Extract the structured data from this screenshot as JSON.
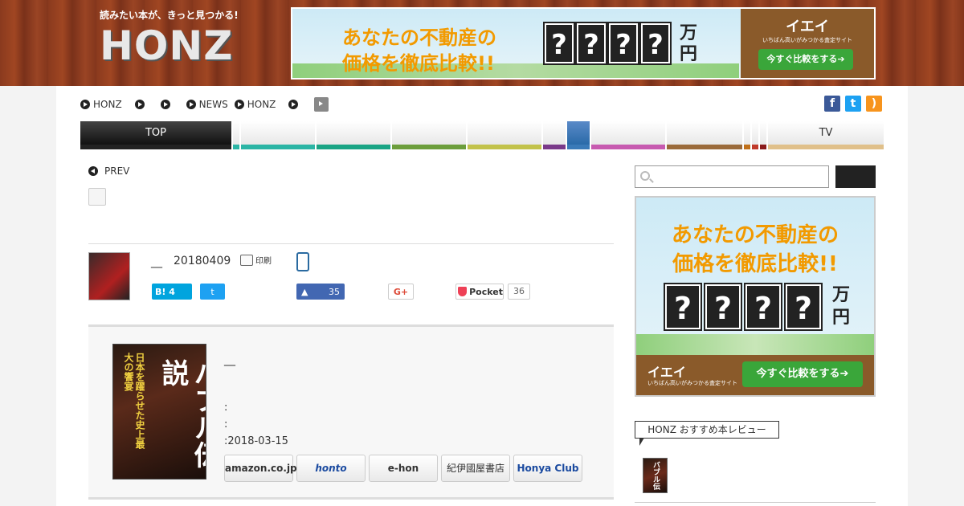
{
  "header": {
    "tagline": "読みたい本が、きっと見つかる!",
    "logo": "HONZ",
    "banner": {
      "line1": "あなたの不動産の",
      "line2": "価格を徹底比較!!",
      "mark": "?",
      "unit": "万円",
      "brand": "イエイ",
      "sub": "いちばん高いがみつかる査定サイト",
      "cta": "今すぐ比較をする➔"
    }
  },
  "breadcrumb": {
    "items": [
      "HONZ",
      "",
      "",
      "NEWS",
      "HONZ",
      "",
      ""
    ]
  },
  "social_colors": {
    "facebook": "#3b5998",
    "twitter": "#1da1f2",
    "rss": "#f7941d"
  },
  "nav": {
    "top_label": "TOP",
    "tv_label": "TV",
    "colors": [
      "#222222",
      "#2bb5a5",
      "#1aa585",
      "#16956a",
      "#6c9e3c",
      "#c2c24a",
      "#7a3a8a",
      "#3a7ab8",
      "#c75ab0",
      "#9a6a3a",
      "#c0701a",
      "#c03a2a",
      "#8a1a1a",
      "#e0c08a"
    ]
  },
  "article": {
    "prev_label": "PREV",
    "author_name": "__",
    "date": "20180409",
    "print_label": "印刷",
    "hatena_label": "B!",
    "hatena_count": "4",
    "fb_count": "35",
    "gplus_label": "G+",
    "pocket_label": "Pocket",
    "pocket_count": "36"
  },
  "book": {
    "cover_sub": "日本を躍らせた史上最大の饗宴",
    "cover_title": "バブル伝説",
    "title": "__",
    "meta1": ":",
    "meta2": ":",
    "meta3": ":2018-03-15",
    "stores": [
      "amazon.co.jp",
      "honto",
      "e-hon",
      "紀伊國屋書店",
      "Honya Club"
    ]
  },
  "sidebar": {
    "search_placeholder": "",
    "ad": {
      "line1": "あなたの不動産の",
      "line2": "価格を徹底比較!!",
      "mark": "?",
      "unit": "万円",
      "brand": "イエイ",
      "sub": "いちばん高いがみつかる査定サイト",
      "cta": "今すぐ比較をする➔"
    },
    "recommend_title": "HONZ おすすめ本レビュー",
    "recommend_thumb": "バブル伝説"
  }
}
